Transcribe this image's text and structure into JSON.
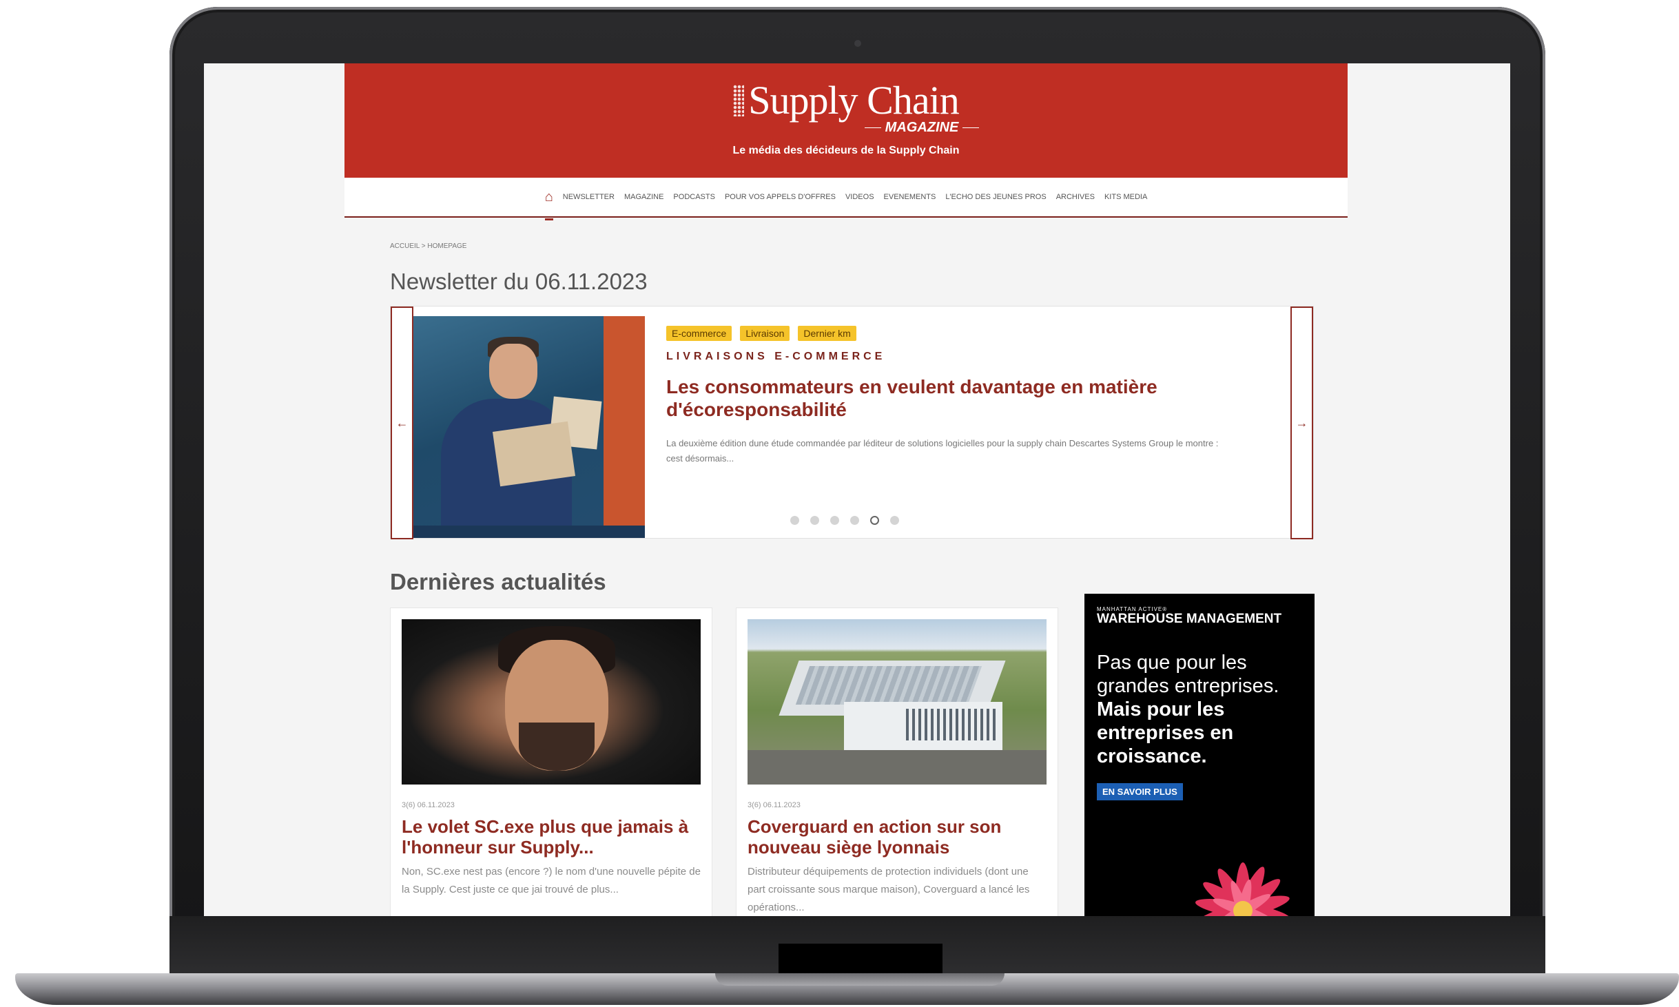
{
  "site": {
    "logo": "Supply Chain",
    "logo_sub": "MAGAZINE",
    "tagline": "Le média des décideurs de la Supply Chain"
  },
  "nav": {
    "items": [
      "NEWSLETTER",
      "MAGAZINE",
      "PODCASTS",
      "POUR VOS APPELS D'OFFRES",
      "VIDEOS",
      "EVENEMENTS",
      "L'ECHO DES JEUNES PROS",
      "ARCHIVES",
      "KITS MEDIA"
    ]
  },
  "breadcrumb": {
    "items": [
      "ACCUEIL",
      "HOMEPAGE"
    ],
    "separator": ">"
  },
  "page_title": "Newsletter du 06.11.2023",
  "slider": {
    "tags": [
      "E-commerce",
      "Livraison",
      "Dernier km"
    ],
    "kicker": "LIVRAISONS E-COMMERCE",
    "title": "Les consommateurs en veulent davantage en matière d'écoresponsabilité",
    "excerpt": "La deuxième édition dune étude commandée par léditeur de solutions logicielles pour la supply chain Descartes Systems Group le montre : cest désormais...",
    "arrow_left": "←",
    "arrow_right": "→",
    "dots_count": 6,
    "active_dot": 5
  },
  "section_title": "Dernières actualités",
  "cards": [
    {
      "date": "3(6) 06.11.2023",
      "title": "Le volet SC.exe plus que jamais à l'honneur sur Supply...",
      "excerpt": "Non, SC.exe nest pas (encore ?) le nom d'une nouvelle pépite de la Supply. Cest juste ce que jai trouvé de plus..."
    },
    {
      "date": "3(6) 06.11.2023",
      "title": "Coverguard en action sur son nouveau siège lyonnais",
      "excerpt": "Distributeur déquipements de protection individuels (dont une part croissante sous marque maison), Coverguard a lancé les opérations..."
    }
  ],
  "ad": {
    "brand_small": "MANHATTAN ACTIVE®",
    "brand": "WAREHOUSE MANAGEMENT",
    "line1": "Pas que pour les grandes entreprises.",
    "line2": "Mais pour les entreprises en croissance.",
    "cta": "EN SAVOIR PLUS"
  },
  "colors": {
    "brand_red": "#bf2e23",
    "title_red": "#8e2b22",
    "tag_yellow": "#f5c32a",
    "ad_cta_blue": "#1c5fb4"
  },
  "icons": [
    "home-icon",
    "arrow-left-icon",
    "arrow-right-icon"
  ]
}
